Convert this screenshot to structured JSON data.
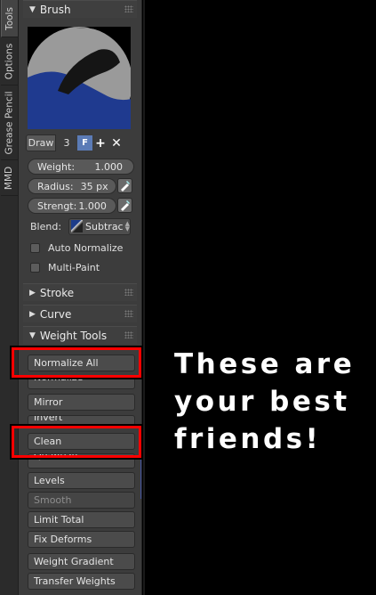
{
  "tabs": [
    {
      "label": "Tools",
      "active": true
    },
    {
      "label": "Options",
      "active": false
    },
    {
      "label": "Grease Pencil",
      "active": false
    },
    {
      "label": "MMD",
      "active": false
    }
  ],
  "brush": {
    "header": "Brush",
    "draw_label": "Draw",
    "brush_number": "3",
    "fake_user": "F",
    "add_icon": "+",
    "remove_icon": "✕",
    "weight_label": "Weight:",
    "weight_value": "1.000",
    "radius_label": "Radius:",
    "radius_value": "35 px",
    "strength_label": "Strengt:",
    "strength_value": "1.000",
    "blend_label": "Blend:",
    "blend_value": "Subtrac",
    "auto_normalize": "Auto Normalize",
    "multi_paint": "Multi-Paint"
  },
  "sections": {
    "stroke": "Stroke",
    "curve": "Curve",
    "weight_tools": "Weight Tools"
  },
  "weight_tools": {
    "normalize_all": "Normalize All",
    "normalize": "Normalize",
    "mirror": "Mirror",
    "invert": "Invert",
    "clean": "Clean",
    "quantize": "Quantize",
    "levels": "Levels",
    "smooth": "Smooth",
    "limit_total": "Limit Total",
    "fix_deforms": "Fix Deforms",
    "weight_gradient": "Weight Gradient",
    "transfer_weights": "Transfer Weights"
  },
  "caption": "These are\nyour best\nfriends!",
  "colors": {
    "highlight": "#ff0000",
    "panel": "#3c3c3c",
    "accent_blue": "#5b7bb6"
  }
}
